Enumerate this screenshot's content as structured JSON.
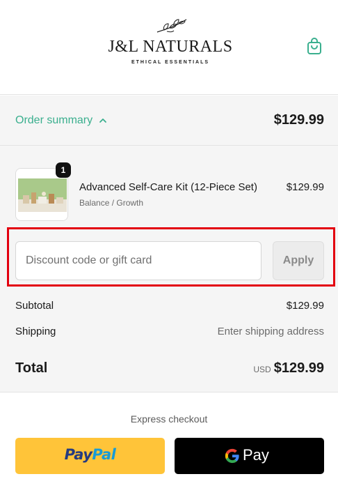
{
  "brand": {
    "name": "J&L NATURALS",
    "tagline": "ETHICAL ESSENTIALS"
  },
  "icons": {
    "cart": "shopping-bag-icon",
    "toggle": "chevron-up-icon",
    "logo": "leaf-branch-icon",
    "google": "google-g-icon"
  },
  "colors": {
    "accent": "#3aaf8e",
    "highlight": "#e3000f",
    "paypal_yellow": "#ffc439",
    "paypal_dark": "#253b80",
    "paypal_light": "#179bd7"
  },
  "summary": {
    "toggle_label": "Order summary",
    "total": "$129.99"
  },
  "line_items": [
    {
      "quantity": "1",
      "name": "Advanced Self-Care Kit (12-Piece Set)",
      "variant": "Balance / Growth",
      "price": "$129.99"
    }
  ],
  "discount": {
    "placeholder": "Discount code or gift card",
    "apply_label": "Apply"
  },
  "totals": {
    "subtotal_label": "Subtotal",
    "subtotal_value": "$129.99",
    "shipping_label": "Shipping",
    "shipping_value": "Enter shipping address",
    "total_label": "Total",
    "currency": "USD",
    "total_value": "$129.99"
  },
  "express": {
    "label": "Express checkout",
    "paypal_part1": "Pay",
    "paypal_part2": "Pal",
    "gpay_label": "Pay"
  }
}
